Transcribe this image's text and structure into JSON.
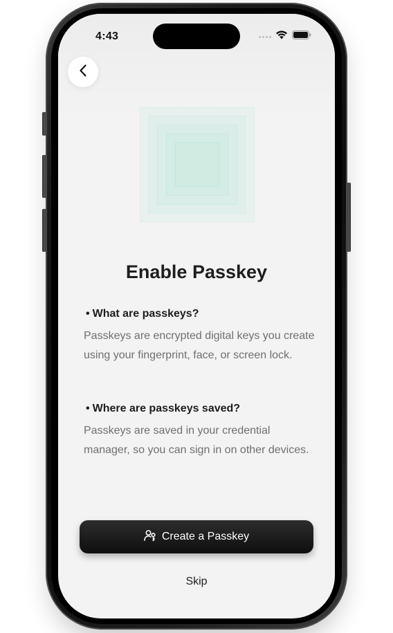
{
  "status_bar": {
    "time": "4:43",
    "wifi_icon": "wifi-icon",
    "battery_icon": "battery-icon"
  },
  "nav": {
    "back_icon": "chevron-left-icon"
  },
  "illustration": {
    "icon": "passkey-illustration",
    "color": "#d9efe8"
  },
  "content": {
    "title": "Enable Passkey",
    "sections": [
      {
        "heading": "What are passkeys?",
        "body": "Passkeys are encrypted digital keys you create using your fingerprint, face, or screen lock."
      },
      {
        "heading": "Where are passkeys saved?",
        "body": "Passkeys are saved in your credential manager, so you can sign in on other devices."
      }
    ],
    "bullet": "•"
  },
  "actions": {
    "primary_label": "Create a Passkey",
    "primary_icon": "user-key-icon",
    "primary_color": "#111111",
    "skip_label": "Skip"
  }
}
